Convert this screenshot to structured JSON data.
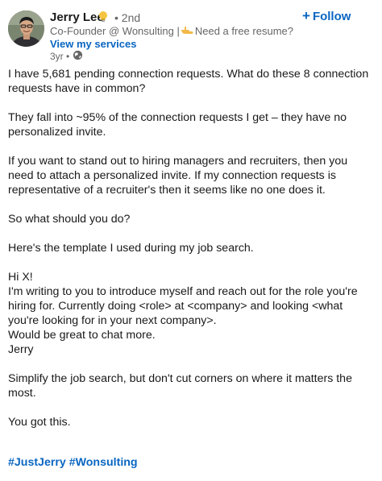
{
  "author": {
    "name": "Jerry Lee",
    "degree": "• 2nd",
    "headline_before": "Co-Founder @ Wonsulting |",
    "headline_after": "Need a free resume? Visit ...",
    "services_link": "View my services",
    "time": "3yr •",
    "icons": {
      "avatar": "profile-photo",
      "badge": "lightbulb-icon",
      "pointer": "pointing-hand-icon",
      "visibility": "globe-icon"
    }
  },
  "actions": {
    "follow_plus": "+",
    "follow_label": "Follow"
  },
  "post": {
    "p1": "I have 5,681 pending connection requests. What do these 8 connection requests have in common?",
    "p2": "They fall into ~95% of the connection requests I get – they have no personalized invite.",
    "p3": "If you want to stand out to hiring managers and recruiters, then you need to attach a personalized invite. If my connection requests is representative of a recruiter's then it seems like no one does it.",
    "p4": "So what should you do?",
    "p5": "Here's the template I used during my job search.",
    "template_greeting": "Hi X!",
    "template_body": "I'm writing to you to introduce myself and reach out for the role you're hiring for. Currently doing <role> at <company> and looking <what you're looking for in your next company>.",
    "template_closing": "Would be great to chat more.",
    "template_signature": "Jerry",
    "p6": "Simplify the job search, but don't cut corners on where it matters the most.",
    "p7": "You got this.",
    "hashtags": [
      "#JustJerry",
      "#Wonsulting"
    ]
  },
  "colors": {
    "link_blue": "#0a66c2",
    "text_primary": "#191919",
    "text_secondary": "#666666"
  }
}
